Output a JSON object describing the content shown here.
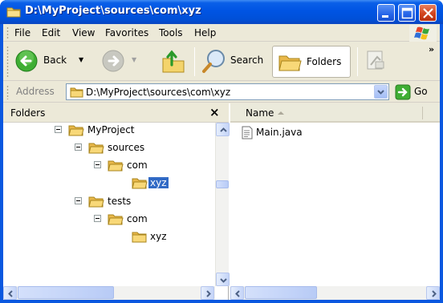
{
  "window": {
    "title": "D:\\MyProject\\sources\\com\\xyz",
    "colors": {
      "titlebar": "#0054e3",
      "selection": "#316ac5",
      "chrome": "#ece9d8"
    }
  },
  "menu": [
    {
      "label": "File"
    },
    {
      "label": "Edit"
    },
    {
      "label": "View"
    },
    {
      "label": "Favorites"
    },
    {
      "label": "Tools"
    },
    {
      "label": "Help"
    }
  ],
  "toolbar": {
    "back": "Back",
    "search": "Search",
    "folders": "Folders"
  },
  "address": {
    "label": "Address",
    "value": "D:\\MyProject\\sources\\com\\xyz",
    "go": "Go"
  },
  "folders_pane": {
    "title": "Folders",
    "close": "×",
    "tree": [
      {
        "label": "MyProject",
        "expanded": true,
        "selected": false
      },
      {
        "label": "sources",
        "expanded": true,
        "selected": false
      },
      {
        "label": "com",
        "expanded": true,
        "selected": false
      },
      {
        "label": "xyz",
        "expanded": false,
        "selected": true
      },
      {
        "label": "tests",
        "expanded": true,
        "selected": false
      },
      {
        "label": "com",
        "expanded": true,
        "selected": false
      },
      {
        "label": "xyz",
        "expanded": false,
        "selected": false
      }
    ]
  },
  "file_pane": {
    "column_name": "Name",
    "files": [
      {
        "name": "Main.java",
        "icon": "text-file-icon"
      }
    ]
  }
}
